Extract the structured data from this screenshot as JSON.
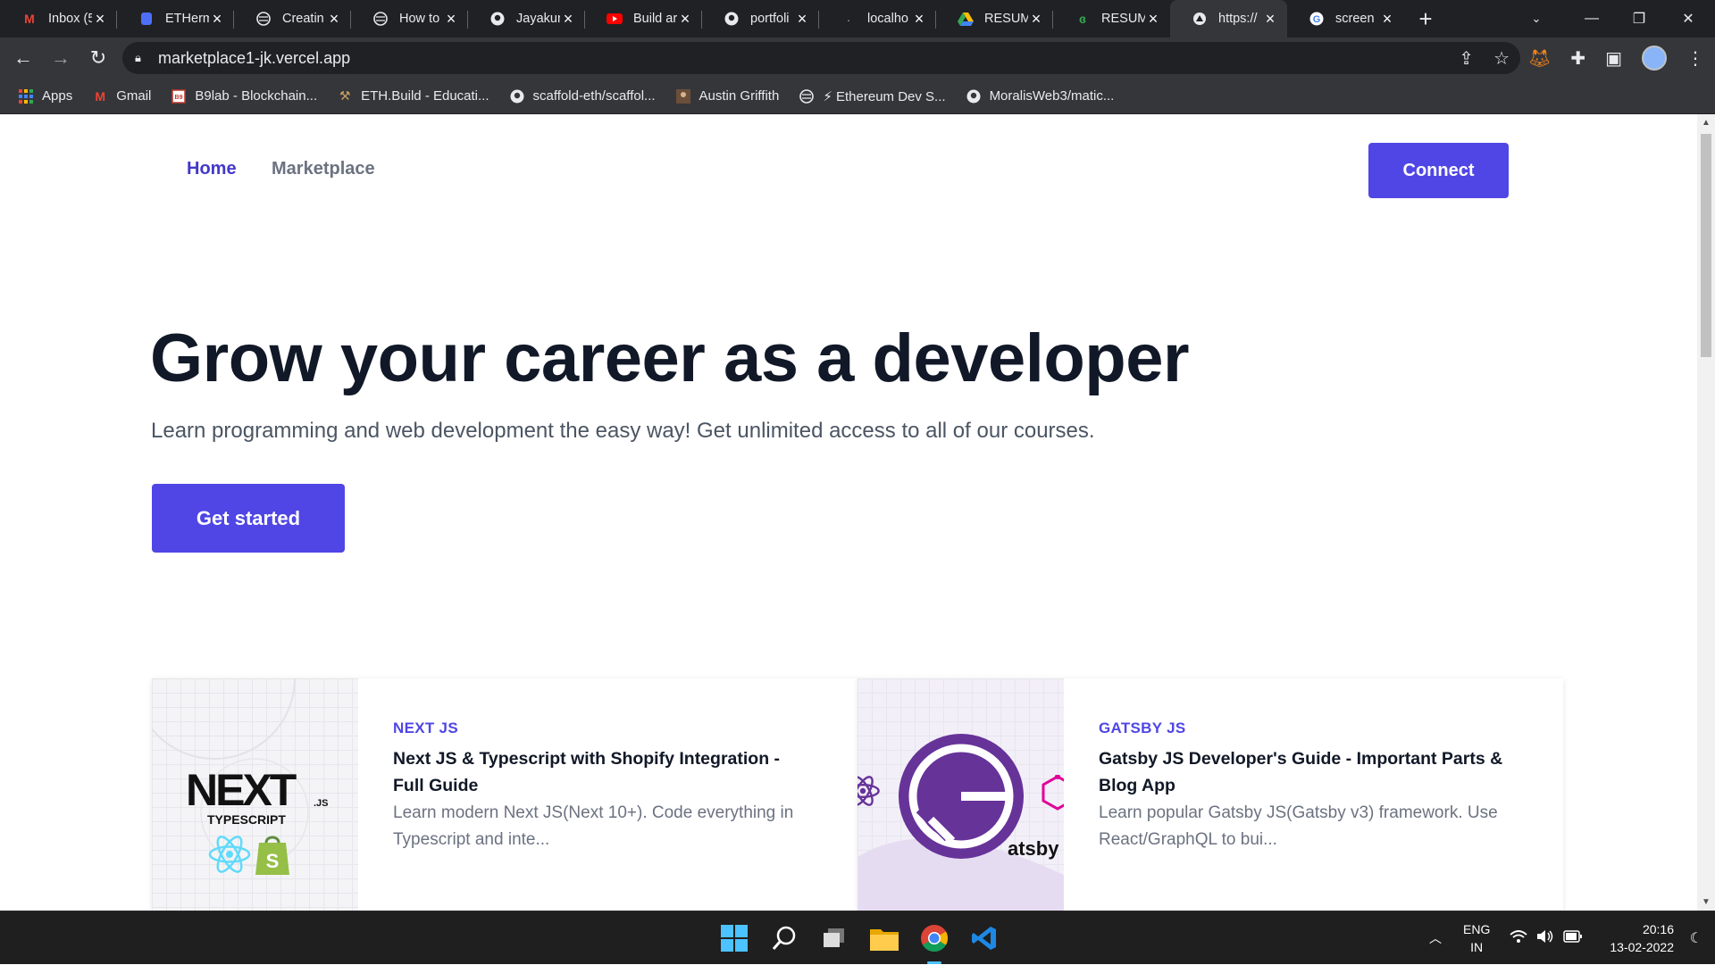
{
  "browser": {
    "tabs": [
      {
        "title": "Inbox (5",
        "icon": "gmail-icon"
      },
      {
        "title": "ETHerm",
        "icon": "doc-icon"
      },
      {
        "title": "Creatin",
        "icon": "globe-icon"
      },
      {
        "title": "How to",
        "icon": "globe-icon"
      },
      {
        "title": "Jayakun",
        "icon": "github-icon"
      },
      {
        "title": "Build ar",
        "icon": "youtube-icon"
      },
      {
        "title": "portfoli",
        "icon": "github-icon"
      },
      {
        "title": "localho",
        "icon": "loading-icon"
      },
      {
        "title": "RESUM",
        "icon": "drive-icon"
      },
      {
        "title": "RESUM",
        "icon": "leaf-icon"
      },
      {
        "title": "https://",
        "icon": "vercel-icon"
      },
      {
        "title": "screen",
        "icon": "google-icon"
      }
    ],
    "active_tab_index": 10,
    "url": "marketplace1-jk.vercel.app",
    "bookmarks": [
      {
        "label": "Apps",
        "icon": "apps-grid-icon"
      },
      {
        "label": "Gmail",
        "icon": "gmail-icon"
      },
      {
        "label": "B9lab - Blockchain...",
        "icon": "b9lab-icon"
      },
      {
        "label": "ETH.Build - Educati...",
        "icon": "tools-icon"
      },
      {
        "label": "scaffold-eth/scaffol...",
        "icon": "github-icon"
      },
      {
        "label": "Austin Griffith",
        "icon": "person-icon"
      },
      {
        "label": "⚡ Ethereum Dev S...",
        "icon": "globe-icon"
      },
      {
        "label": "MoralisWeb3/matic...",
        "icon": "github-icon"
      }
    ]
  },
  "site": {
    "nav": {
      "home": "Home",
      "marketplace": "Marketplace",
      "connect": "Connect"
    },
    "hero": {
      "title": "Grow your career as a developer",
      "subtitle": "Learn programming and web development the easy way! Get unlimited access to all of our courses.",
      "cta": "Get started"
    },
    "courses": [
      {
        "category": "NEXT JS",
        "title": "Next JS & Typescript with Shopify Integration - Full Guide",
        "description": "Learn modern Next JS(Next 10+). Code everything in Typescript and inte...",
        "thumb_text": "NEXT",
        "thumb_sub": "TYPESCRIPT",
        "thumb_suffix": ".JS"
      },
      {
        "category": "GATSBY JS",
        "title": "Gatsby JS Developer's Guide - Important Parts & Blog App",
        "description": "Learn popular Gatsby JS(Gatsby v3) framework. Use React/GraphQL to bui...",
        "thumb_text": "atsby"
      }
    ]
  },
  "taskbar": {
    "apps": [
      "windows-start-icon",
      "search-icon",
      "task-view-icon",
      "file-explorer-icon",
      "chrome-icon",
      "vscode-icon"
    ],
    "lang_top": "ENG",
    "lang_bottom": "IN",
    "time": "20:16",
    "date": "13-02-2022"
  },
  "colors": {
    "accent": "#4f46e5",
    "heading": "#111827",
    "muted": "#6b7280"
  }
}
